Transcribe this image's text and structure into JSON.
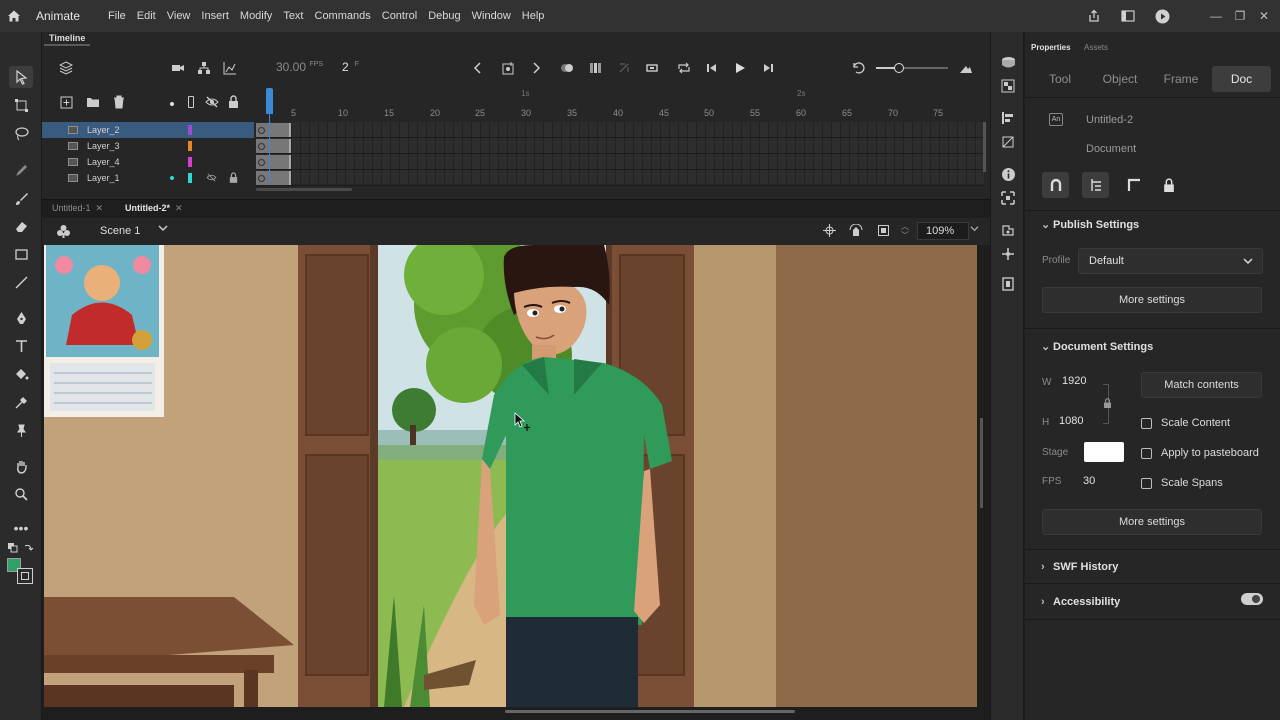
{
  "app": {
    "name": "Animate"
  },
  "menu": [
    "File",
    "Edit",
    "View",
    "Insert",
    "Modify",
    "Text",
    "Commands",
    "Control",
    "Debug",
    "Window",
    "Help"
  ],
  "timeline": {
    "tab_label": "Timeline",
    "fps": "30.00",
    "fps_unit": "FPS",
    "current_frame": "2",
    "frame_unit": "F",
    "ruler_numbers": [
      "5",
      "10",
      "15",
      "20",
      "25",
      "30",
      "35",
      "40",
      "45",
      "50",
      "55",
      "60",
      "65",
      "70",
      "75"
    ],
    "ruler_seconds": [
      "1s",
      "2s"
    ],
    "layers": [
      {
        "name": "Layer_2",
        "color": "#9b4dd1",
        "selected": true
      },
      {
        "name": "Layer_3",
        "color": "#e8872a",
        "selected": false
      },
      {
        "name": "Layer_4",
        "color": "#d53fd0",
        "selected": false
      },
      {
        "name": "Layer_1",
        "color": "#33d6d0",
        "selected": false
      }
    ]
  },
  "documents": {
    "tabs": [
      {
        "label": "Untitled-1",
        "active": false
      },
      {
        "label": "Untitled-2*",
        "active": true
      }
    ]
  },
  "scene": {
    "label": "Scene 1",
    "zoom": "109%"
  },
  "properties": {
    "tab_properties": "Properties",
    "tab_assets": "Assets",
    "subtabs": [
      "Tool",
      "Object",
      "Frame",
      "Doc"
    ],
    "active_subtab": "Doc",
    "doc_name": "Untitled-2",
    "doc_type": "Document",
    "publish": {
      "title": "Publish Settings",
      "profile_label": "Profile",
      "profile_value": "Default",
      "more_settings": "More settings"
    },
    "document_settings": {
      "title": "Document Settings",
      "w_label": "W",
      "w_value": "1920",
      "h_label": "H",
      "h_value": "1080",
      "match_contents": "Match contents",
      "scale_content": "Scale Content",
      "stage_label": "Stage",
      "stage_color": "#ffffff",
      "apply_to_pasteboard": "Apply to pasteboard",
      "fps_label": "FPS",
      "fps_value": "30",
      "scale_spans": "Scale Spans",
      "more_settings": "More settings"
    },
    "swf_history": "SWF History",
    "accessibility": "Accessibility"
  }
}
